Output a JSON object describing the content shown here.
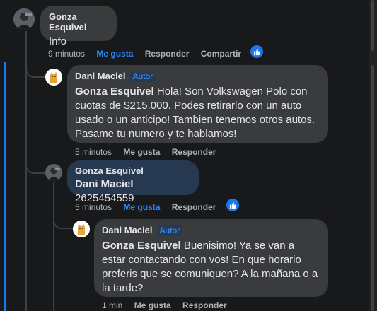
{
  "comments": [
    {
      "author": "Gonza Esquivel",
      "text": "Info",
      "time": "9 minutos",
      "actions": {
        "like": "Me gusta",
        "reply": "Responder",
        "share": "Compartir"
      }
    },
    {
      "author": "Dani Maciel",
      "badge": "Autor",
      "mention": "Gonza Esquivel",
      "text": "Hola! Son Volkswagen Polo con cuotas de $215.000. Podes retirarlo con un auto usado o un anticipo! Tambien tenemos otros autos. Pasame tu numero y te hablamos!",
      "time": "5 minutos",
      "actions": {
        "like": "Me gusta",
        "reply": "Responder"
      }
    },
    {
      "author": "Gonza Esquivel",
      "mention": "Dani Maciel",
      "text": "2625454559",
      "time": "5 minutos",
      "actions": {
        "like": "Me gusta",
        "reply": "Responder"
      }
    },
    {
      "author": "Dani Maciel",
      "badge": "Autor",
      "mention": "Gonza Esquivel",
      "text": "Buenisimo! Ya se van a estar contactando con vos! En que horario preferis que se comuniquen? A la mañana o a la tarde?",
      "time": "1 min",
      "actions": {
        "like": "Me gusta",
        "reply": "Responder"
      }
    }
  ],
  "colors": {
    "background": "#18191a",
    "bubble": "#3a3b3c",
    "bubble_highlight": "#263951",
    "accent": "#2d88ff",
    "muted": "#b0b3b8"
  },
  "icons": [
    "like-reaction-icon",
    "user-avatar",
    "cat-avatar"
  ]
}
